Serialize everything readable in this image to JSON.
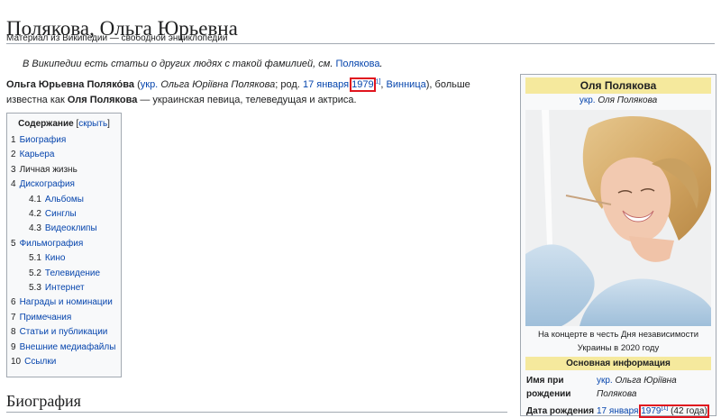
{
  "page": {
    "title": "Полякова, Ольга Юрьевна",
    "tagline": "Материал из Википедии — свободной энциклопедии"
  },
  "hatnote": {
    "text": "В Википедии есть статьи о других людях с такой фамилией, см.",
    "link": "Полякова",
    "end": "."
  },
  "lead": {
    "name_bold": "Ольга Юрьевна Поляко́ва",
    "paren_open": " (",
    "lang_link": "укр.",
    "native_name": "Ольга Юріївна Полякова",
    "born_prefix": "; род.",
    "birth_date_link": "17 января",
    "birth_year_link": "1979",
    "ref": "[1]",
    "comma": ",",
    "city_link": "Винница",
    "paren_close": "), больше известна как",
    "stage_name_bold": "Оля Полякова",
    "rest": " — украинская певица, телеведущая и актриса."
  },
  "toc": {
    "title": "Содержание",
    "toggle": "скрыть",
    "items": [
      {
        "num": "1",
        "label": "Биография",
        "level": 1,
        "linked": true
      },
      {
        "num": "2",
        "label": "Карьера",
        "level": 1,
        "linked": true
      },
      {
        "num": "3",
        "label": "Личная жизнь",
        "level": 1,
        "linked": false
      },
      {
        "num": "4",
        "label": "Дискография",
        "level": 1,
        "linked": true
      },
      {
        "num": "4.1",
        "label": "Альбомы",
        "level": 2,
        "linked": true
      },
      {
        "num": "4.2",
        "label": "Синглы",
        "level": 2,
        "linked": true
      },
      {
        "num": "4.3",
        "label": "Видеоклипы",
        "level": 2,
        "linked": true
      },
      {
        "num": "5",
        "label": "Фильмография",
        "level": 1,
        "linked": true
      },
      {
        "num": "5.1",
        "label": "Кино",
        "level": 2,
        "linked": true
      },
      {
        "num": "5.2",
        "label": "Телевидение",
        "level": 2,
        "linked": true
      },
      {
        "num": "5.3",
        "label": "Интернет",
        "level": 2,
        "linked": true
      },
      {
        "num": "6",
        "label": "Награды и номинации",
        "level": 1,
        "linked": true
      },
      {
        "num": "7",
        "label": "Примечания",
        "level": 1,
        "linked": true
      },
      {
        "num": "8",
        "label": "Статьи и публикации",
        "level": 1,
        "linked": true
      },
      {
        "num": "9",
        "label": "Внешние медиафайлы",
        "level": 1,
        "linked": true
      },
      {
        "num": "10",
        "label": "Ссылки",
        "level": 1,
        "linked": true
      }
    ]
  },
  "section": {
    "heading": "Биография"
  },
  "infobox": {
    "name": "Оля Полякова",
    "native_lang": "укр.",
    "native_name": "Оля Полякова",
    "caption": "На концерте в честь Дня независимости Украины в 2020 году",
    "section_title": "Основная информация",
    "birth_name_label": "Имя при рождении",
    "birth_name_lang": "укр.",
    "birth_name_value": "Ольга Юріївна Полякова",
    "birth_date_label": "Дата рождения",
    "birth_date_link": "17 января",
    "birth_year_link": "1979",
    "birth_ref": "[1]",
    "age": "(42 года)"
  },
  "colors": {
    "link": "#0645ad",
    "infobox_header": "#f5e99d",
    "highlight_box": "#e0141e"
  }
}
